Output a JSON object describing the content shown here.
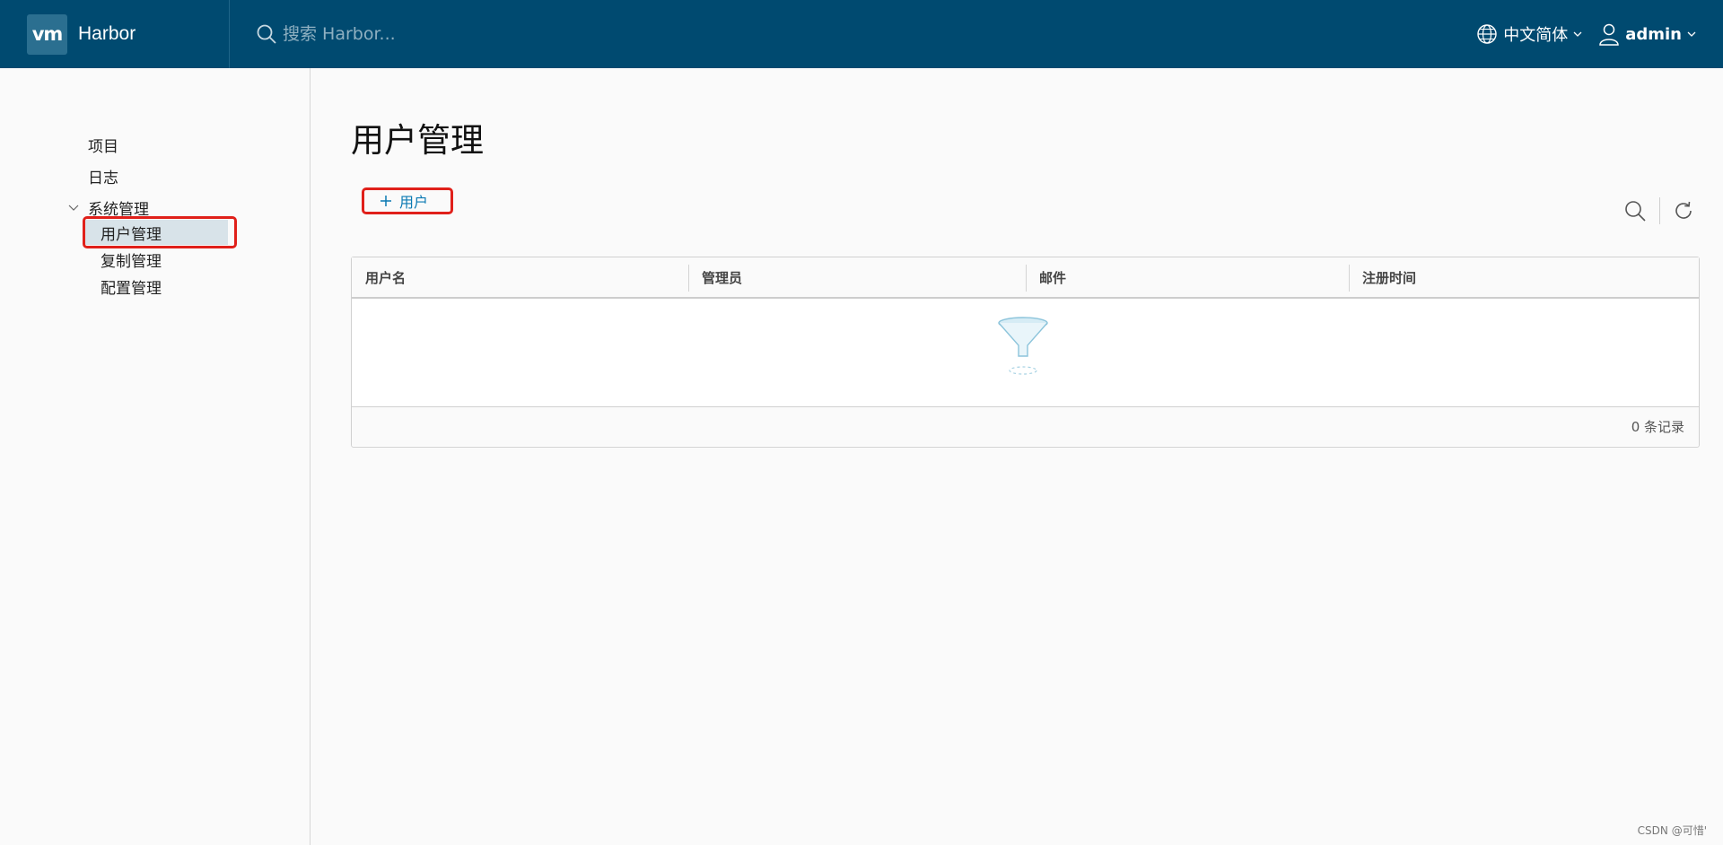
{
  "header": {
    "logo_text": "vm",
    "brand": "Harbor",
    "search_placeholder": "搜索 Harbor...",
    "language": "中文简体",
    "user": "admin"
  },
  "sidebar": {
    "items": [
      {
        "label": "项目"
      },
      {
        "label": "日志"
      },
      {
        "label": "系统管理"
      }
    ],
    "sub_items": [
      {
        "label": "用户管理",
        "active": true
      },
      {
        "label": "复制管理"
      },
      {
        "label": "配置管理"
      }
    ]
  },
  "main": {
    "title": "用户管理",
    "add_button": "用户",
    "table": {
      "columns": [
        "用户名",
        "管理员",
        "邮件",
        "注册时间"
      ],
      "rows": [],
      "footer": "0 条记录"
    }
  },
  "watermark": "CSDN @可惜'",
  "colors": {
    "header_bg": "#004a70",
    "accent": "#0a79b3",
    "highlight": "#e0201a"
  }
}
